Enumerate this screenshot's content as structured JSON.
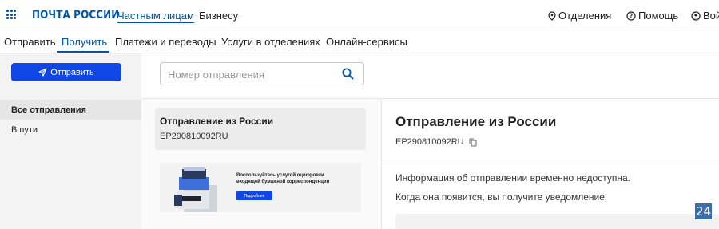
{
  "header": {
    "logo": "ПОЧТА РОССИИ",
    "nav": [
      "Частным лицам",
      "Бизнесу"
    ],
    "right": {
      "offices": "Отделения",
      "help": "Помощь",
      "login": "Вой"
    }
  },
  "subnav": {
    "items": [
      "Отправить",
      "Получить",
      "Платежи и переводы",
      "Услуги в отделениях",
      "Онлайн-сервисы"
    ],
    "active": "Получить"
  },
  "sidebar": {
    "send_button": "Отправить",
    "items": [
      "Все отправления",
      "В пути"
    ]
  },
  "search": {
    "placeholder": "Номер отправления",
    "value": ""
  },
  "shipment_card": {
    "title": "Отправление из России",
    "id": "EP290810092RU"
  },
  "promo": {
    "text": "Воспользуйтесь услугой оцифровки входящей бумажной корреспонденции",
    "button": "Подробнее"
  },
  "detail": {
    "title": "Отправление из России",
    "id": "EP290810092RU",
    "message_1": "Информация об отправлении временно недоступна.",
    "message_2": "Когда она появится, вы получите уведомление."
  },
  "corner_badge": "24",
  "colors": {
    "brand": "#0055a6",
    "button": "#1045e6"
  }
}
